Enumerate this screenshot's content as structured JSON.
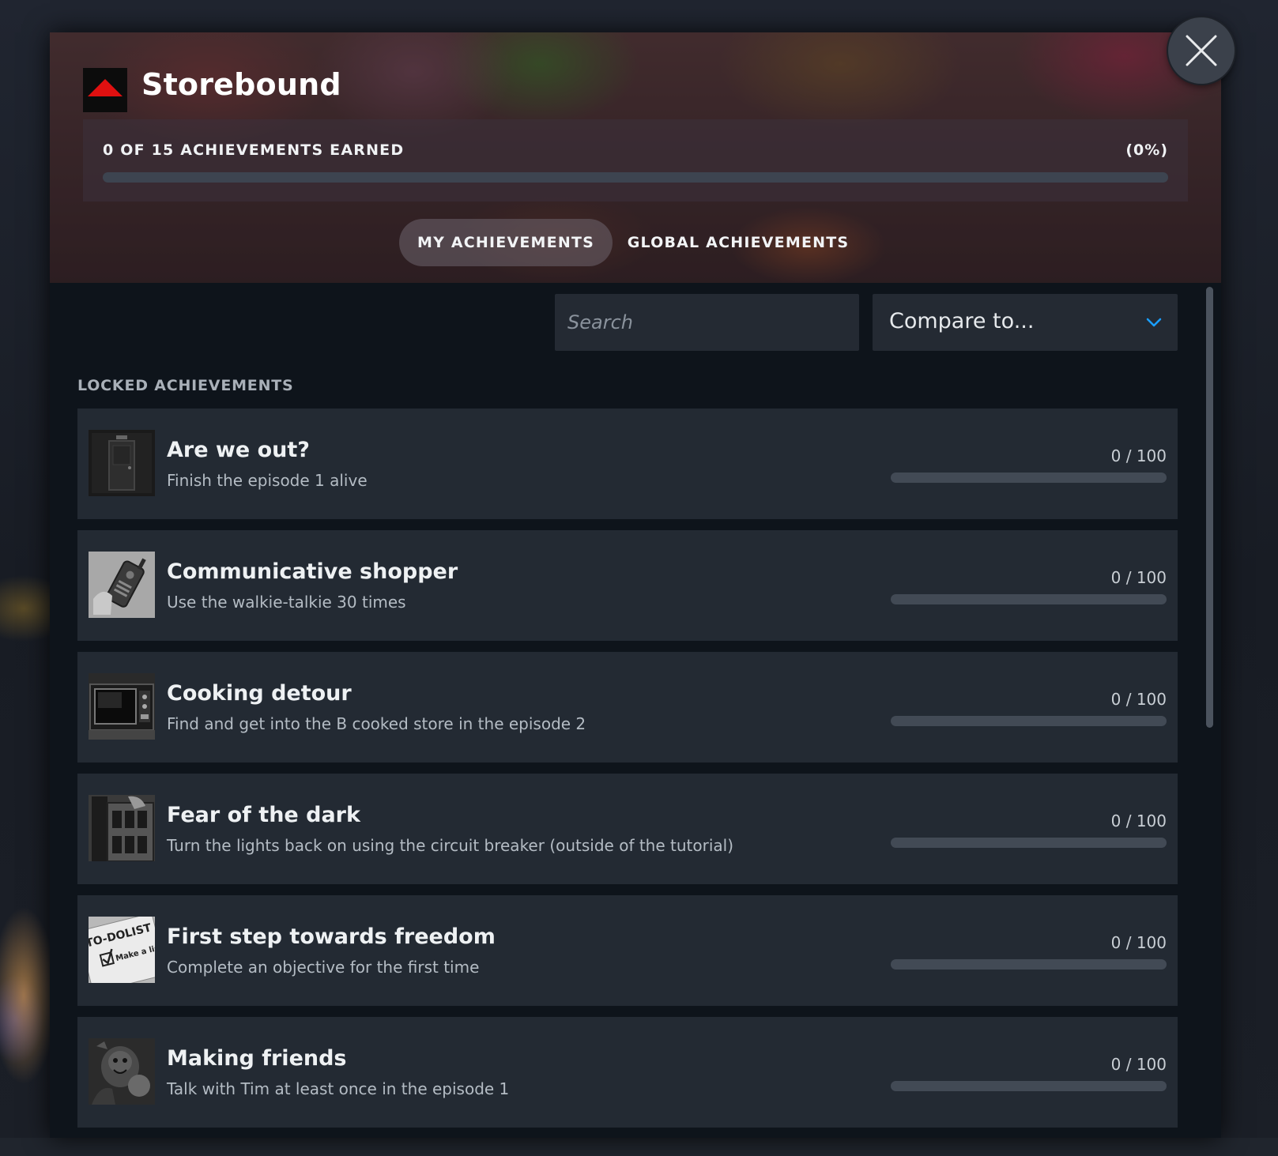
{
  "game": {
    "title": "Storebound",
    "logo_icon": "red-triangle-logo"
  },
  "progress": {
    "label": "0 OF 15 ACHIEVEMENTS EARNED",
    "percent_text": "(0%)",
    "fraction": 0
  },
  "tabs": [
    {
      "label": "MY ACHIEVEMENTS",
      "active": true
    },
    {
      "label": "GLOBAL ACHIEVEMENTS",
      "active": false
    }
  ],
  "search": {
    "placeholder": "Search",
    "value": ""
  },
  "compare": {
    "label": "Compare to...",
    "icon": "chevron-down-icon"
  },
  "section": {
    "label": "LOCKED ACHIEVEMENTS"
  },
  "achievements": [
    {
      "name": "Are we out?",
      "description": "Finish the episode 1 alive",
      "progress_text": "0 / 100",
      "fraction": 0,
      "icon": "exit-door-icon"
    },
    {
      "name": "Communicative shopper",
      "description": "Use the walkie-talkie 30 times",
      "progress_text": "0 / 100",
      "fraction": 0,
      "icon": "walkie-talkie-icon"
    },
    {
      "name": "Cooking detour",
      "description": "Find and get into the B cooked store in the episode 2",
      "progress_text": "0 / 100",
      "fraction": 0,
      "icon": "microwave-icon"
    },
    {
      "name": "Fear of the dark",
      "description": "Turn the lights back on using the circuit breaker (outside of the tutorial)",
      "progress_text": "0 / 100",
      "fraction": 0,
      "icon": "circuit-breaker-icon"
    },
    {
      "name": "First step towards freedom",
      "description": "Complete an objective for the first time",
      "progress_text": "0 / 100",
      "fraction": 0,
      "icon": "todo-list-icon",
      "icon_text": [
        "TO-DOLIST",
        "Make a list"
      ]
    },
    {
      "name": "Making friends",
      "description": "Talk with Tim at least once in the episode 1",
      "progress_text": "0 / 100",
      "fraction": 0,
      "icon": "creature-icon"
    }
  ],
  "colors": {
    "accent": "#1a9fff",
    "row_bg": "#232a33",
    "panel_bg": "#0e141b",
    "logo_red": "#e01010"
  }
}
